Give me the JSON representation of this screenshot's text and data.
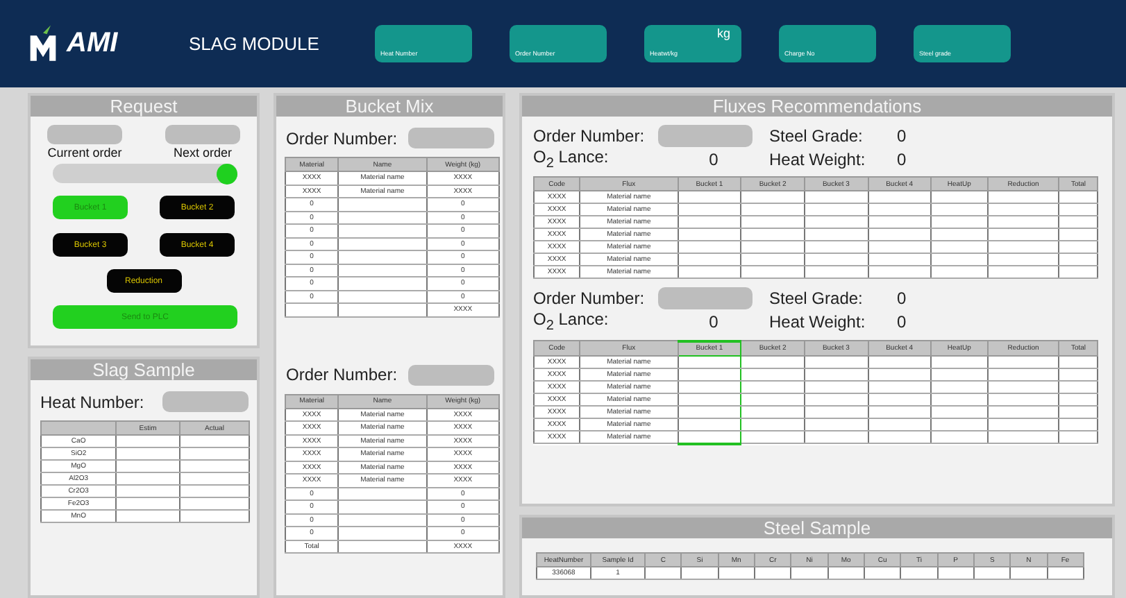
{
  "header": {
    "brand": "AMI",
    "title": "SLAG MODULE",
    "fields": [
      {
        "label": "Heat Number"
      },
      {
        "label": "Order Number"
      },
      {
        "label": "Heatwt/kg",
        "unit": "kg"
      },
      {
        "label": "Charge No"
      },
      {
        "label": "Steel grade"
      }
    ]
  },
  "request": {
    "title": "Request",
    "orders": [
      {
        "label": "Current order"
      },
      {
        "label": "Next order"
      }
    ],
    "toggle": {
      "on": true
    },
    "buckets": [
      {
        "label": "Bucket 1",
        "selected": true
      },
      {
        "label": "Bucket 2",
        "selected": false
      },
      {
        "label": "Bucket 3",
        "selected": false
      },
      {
        "label": "Bucket 4",
        "selected": false
      }
    ],
    "reduction": {
      "label": "Reduction",
      "selected": false
    },
    "send": {
      "label": "Send to PLC"
    }
  },
  "slag_sample": {
    "title": "Slag Sample",
    "heat_label": "Heat Number:",
    "table": {
      "columns": [
        {},
        {
          "label": "Estim"
        },
        {
          "label": "Actual"
        }
      ],
      "rows": [
        [
          "CaO",
          null,
          null
        ],
        [
          "SiO2",
          null,
          null
        ],
        [
          "MgO",
          null,
          null
        ],
        [
          "Al2O3",
          null,
          null
        ],
        [
          "Cr2O3",
          null,
          null
        ],
        [
          "Fe2O3",
          null,
          null
        ],
        [
          "MnO",
          null,
          null
        ]
      ]
    }
  },
  "bucket_mix": {
    "title": "Bucket Mix",
    "sections": [
      {
        "order_label": "Order Number:",
        "table": {
          "columns": [
            {
              "label": "Material"
            },
            {
              "label": "Name"
            },
            {
              "label": "Weight (kg)"
            }
          ],
          "rows": [
            [
              "XXXX",
              "Material name",
              "XXXX"
            ],
            [
              "XXXX",
              "Material name",
              "XXXX"
            ],
            [
              "0",
              null,
              "0"
            ],
            [
              "0",
              null,
              "0"
            ],
            [
              "0",
              null,
              "0"
            ],
            [
              "0",
              null,
              "0"
            ],
            [
              "0",
              null,
              "0"
            ],
            [
              "0",
              null,
              "0"
            ],
            [
              "0",
              null,
              "0"
            ],
            [
              "0",
              null,
              "0"
            ],
            [
              null,
              null,
              "XXXX"
            ]
          ]
        }
      },
      {
        "order_label": "Order Number:",
        "table": {
          "columns": [
            {
              "label": "Material"
            },
            {
              "label": "Name"
            },
            {
              "label": "Weight (kg)"
            }
          ],
          "rows": [
            [
              "XXXX",
              "Material name",
              "XXXX"
            ],
            [
              "XXXX",
              "Material name",
              "XXXX"
            ],
            [
              "XXXX",
              "Material name",
              "XXXX"
            ],
            [
              "XXXX",
              "Material name",
              "XXXX"
            ],
            [
              "XXXX",
              "Material name",
              "XXXX"
            ],
            [
              "XXXX",
              "Material name",
              "XXXX"
            ],
            [
              "0",
              null,
              "0"
            ],
            [
              "0",
              null,
              "0"
            ],
            [
              "0",
              null,
              "0"
            ],
            [
              "0",
              null,
              "0"
            ],
            [
              "Total",
              null,
              "XXXX"
            ]
          ]
        }
      }
    ]
  },
  "fluxes": {
    "title": "Fluxes Recommendations",
    "sections": [
      {
        "order_label": "Order Number:",
        "o2_label": "O$_{2}$ Lance:",
        "o2_value": "0",
        "grade_label": "Steel Grade:",
        "grade_value": "0",
        "weight_label": "Heat Weight:",
        "weight_value": "0",
        "table": {
          "columns": [
            {
              "label": "Code",
              "selected": false
            },
            {
              "label": "Flux",
              "selected": false
            },
            {
              "label": "Bucket 1",
              "selected": false
            },
            {
              "label": "Bucket 2",
              "selected": false
            },
            {
              "label": "Bucket 3",
              "selected": false
            },
            {
              "label": "Bucket 4",
              "selected": false
            },
            {
              "label": "HeatUp",
              "selected": false
            },
            {
              "label": "Reduction",
              "selected": false
            },
            {
              "label": "Total",
              "selected": false
            }
          ],
          "rows": [
            [
              "XXXX",
              "Material name",
              null,
              null,
              null,
              null,
              null,
              null,
              null
            ],
            [
              "XXXX",
              "Material name",
              null,
              null,
              null,
              null,
              null,
              null,
              null
            ],
            [
              "XXXX",
              "Material name",
              null,
              null,
              null,
              null,
              null,
              null,
              null
            ],
            [
              "XXXX",
              "Material name",
              null,
              null,
              null,
              null,
              null,
              null,
              null
            ],
            [
              "XXXX",
              "Material name",
              null,
              null,
              null,
              null,
              null,
              null,
              null
            ],
            [
              "XXXX",
              "Material name",
              null,
              null,
              null,
              null,
              null,
              null,
              null
            ],
            [
              "XXXX",
              "Material name",
              null,
              null,
              null,
              null,
              null,
              null,
              null
            ]
          ]
        }
      },
      {
        "order_label": "Order Number:",
        "o2_label": "O$_{2}$ Lance:",
        "o2_value": "0",
        "grade_label": "Steel Grade:",
        "grade_value": "0",
        "weight_label": "Heat Weight:",
        "weight_value": "0",
        "table": {
          "columns": [
            {
              "label": "Code",
              "selected": false
            },
            {
              "label": "Flux",
              "selected": false
            },
            {
              "label": "Bucket 1",
              "selected": true
            },
            {
              "label": "Bucket 2",
              "selected": false
            },
            {
              "label": "Bucket 3",
              "selected": false
            },
            {
              "label": "Bucket 4",
              "selected": false
            },
            {
              "label": "HeatUp",
              "selected": false
            },
            {
              "label": "Reduction",
              "selected": false
            },
            {
              "label": "Total",
              "selected": false
            }
          ],
          "rows": [
            [
              "XXXX",
              "Material name",
              null,
              null,
              null,
              null,
              null,
              null,
              null
            ],
            [
              "XXXX",
              "Material name",
              null,
              null,
              null,
              null,
              null,
              null,
              null
            ],
            [
              "XXXX",
              "Material name",
              null,
              null,
              null,
              null,
              null,
              null,
              null
            ],
            [
              "XXXX",
              "Material name",
              null,
              null,
              null,
              null,
              null,
              null,
              null
            ],
            [
              "XXXX",
              "Material name",
              null,
              null,
              null,
              null,
              null,
              null,
              null
            ],
            [
              "XXXX",
              "Material name",
              null,
              null,
              null,
              null,
              null,
              null,
              null
            ],
            [
              "XXXX",
              "Material name",
              null,
              null,
              null,
              null,
              null,
              null,
              null
            ]
          ]
        }
      }
    ]
  },
  "steel_sample": {
    "title": "Steel Sample",
    "table": {
      "columns": [
        {
          "label": "HeatNumber"
        },
        {
          "label": "Sample Id"
        },
        {
          "label": "C"
        },
        {
          "label": "Si"
        },
        {
          "label": "Mn"
        },
        {
          "label": "Cr"
        },
        {
          "label": "Ni"
        },
        {
          "label": "Mo"
        },
        {
          "label": "Cu"
        },
        {
          "label": "Ti"
        },
        {
          "label": "P"
        },
        {
          "label": "S"
        },
        {
          "label": "N"
        },
        {
          "label": "Fe"
        }
      ],
      "rows": [
        [
          "336068",
          "1",
          null,
          null,
          null,
          null,
          null,
          null,
          null,
          null,
          null,
          null,
          null,
          null
        ]
      ]
    }
  }
}
